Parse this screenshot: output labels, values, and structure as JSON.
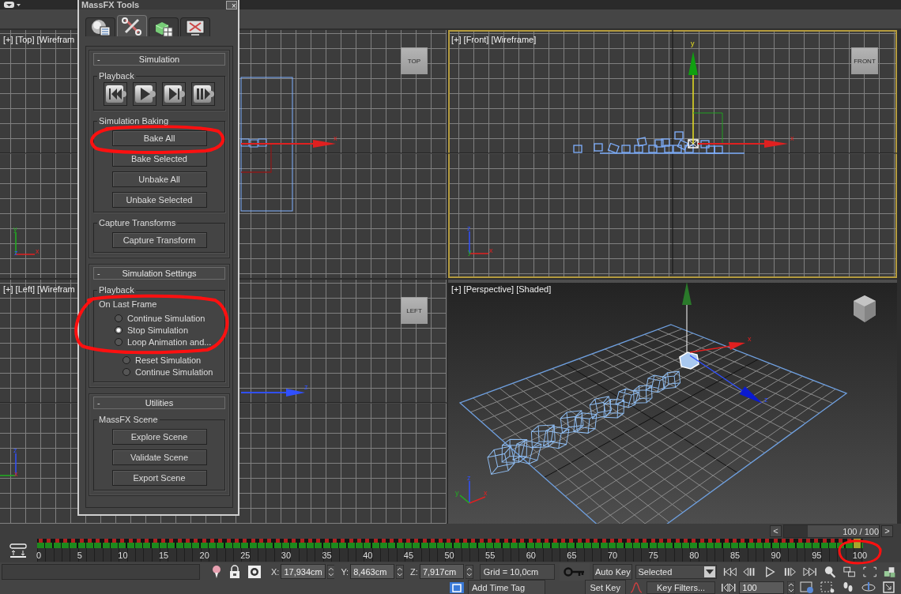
{
  "viewports": [
    {
      "kind": "top",
      "label": "[+] [Top] [Wirefram",
      "view_cube": "TOP",
      "active": false,
      "gizmo_axes": [
        "x"
      ],
      "tripod": [
        "y",
        "z",
        "x"
      ]
    },
    {
      "kind": "front",
      "label": "[+] [Front] [Wireframe]",
      "view_cube": "FRONT",
      "active": true,
      "gizmo_axes": [
        "y",
        "x"
      ],
      "tripod": [
        "z",
        "y",
        "x"
      ]
    },
    {
      "kind": "left",
      "label": "[+] [Left] [Wirefram",
      "view_cube": "LEFT",
      "active": false,
      "gizmo_axes": [
        "z"
      ],
      "tripod": [
        "z",
        "x"
      ]
    },
    {
      "kind": "perspective",
      "label": "[+] [Perspective] [Shaded]",
      "active": false,
      "gizmo_axes": [
        "x",
        "z"
      ],
      "tripod": [
        "z",
        "y",
        "x"
      ]
    }
  ],
  "massfx": {
    "title": "MassFX Tools",
    "close": "×",
    "tabs": [
      {
        "kind": "world",
        "selected": false
      },
      {
        "kind": "tools",
        "selected": true
      },
      {
        "kind": "objects",
        "selected": false
      },
      {
        "kind": "display",
        "selected": false
      }
    ],
    "rollouts": [
      {
        "collapse": "-",
        "title": "Simulation",
        "groups": [
          {
            "title": "Playback",
            "items": [
              {
                "kind": "icon_buttons",
                "icons": [
                  {
                    "kind": "reset"
                  },
                  {
                    "kind": "start"
                  },
                  {
                    "kind": "step"
                  },
                  {
                    "kind": "pause"
                  }
                ]
              }
            ]
          },
          {
            "title": "Simulation Baking",
            "items": [
              {
                "kind": "button",
                "label": "Bake All"
              },
              {
                "kind": "button",
                "label": "Bake Selected"
              },
              {
                "kind": "button",
                "label": "Unbake All"
              },
              {
                "kind": "button",
                "label": "Unbake Selected"
              }
            ]
          },
          {
            "title": "Capture Transforms",
            "items": [
              {
                "kind": "button",
                "label": "Capture Transform"
              }
            ]
          }
        ]
      },
      {
        "collapse": "-",
        "title": "Simulation Settings",
        "groups": [
          {
            "title": "Playback",
            "items": [
              {
                "kind": "label",
                "label": "On Last Frame"
              },
              {
                "kind": "radio",
                "label": "Continue Simulation",
                "selected": false
              },
              {
                "kind": "radio",
                "label": "Stop Simulation",
                "selected": true
              },
              {
                "kind": "radio",
                "label": "Loop Animation and...",
                "selected": false
              },
              {
                "kind": "subradio",
                "label": "Reset Simulation",
                "selected": false
              },
              {
                "kind": "subradio",
                "label": "Continue Simulation",
                "selected": false
              }
            ]
          }
        ]
      },
      {
        "collapse": "-",
        "title": "Utilities",
        "groups": [
          {
            "title": "MassFX Scene",
            "items": [
              {
                "kind": "button",
                "label": "Explore Scene"
              },
              {
                "kind": "button",
                "label": "Validate Scene"
              },
              {
                "kind": "button",
                "label": "Export Scene"
              }
            ]
          }
        ]
      }
    ]
  },
  "time_slider": {
    "prev": "<",
    "text": "100 / 100",
    "next": ">",
    "level": 1
  },
  "timeline": {
    "ticks": [
      "0",
      "5",
      "10",
      "15",
      "20",
      "25",
      "30",
      "35",
      "40",
      "45",
      "50",
      "55",
      "60",
      "65",
      "70",
      "75",
      "80",
      "85",
      "90",
      "95",
      "100"
    ],
    "level": 1
  },
  "status": {
    "coords": [
      {
        "axis": "X:",
        "value": "17,934cm"
      },
      {
        "axis": "Y:",
        "value": "8,463cm"
      },
      {
        "axis": "Z:",
        "value": "7,917cm"
      }
    ],
    "grid": "Grid = 10,0cm",
    "auto_key": "Auto Key",
    "key_mode": "Selected",
    "time_tag": "Add Time Tag",
    "set_key": "Set Key",
    "key_filters": "Key Filters...",
    "frame": "100"
  }
}
